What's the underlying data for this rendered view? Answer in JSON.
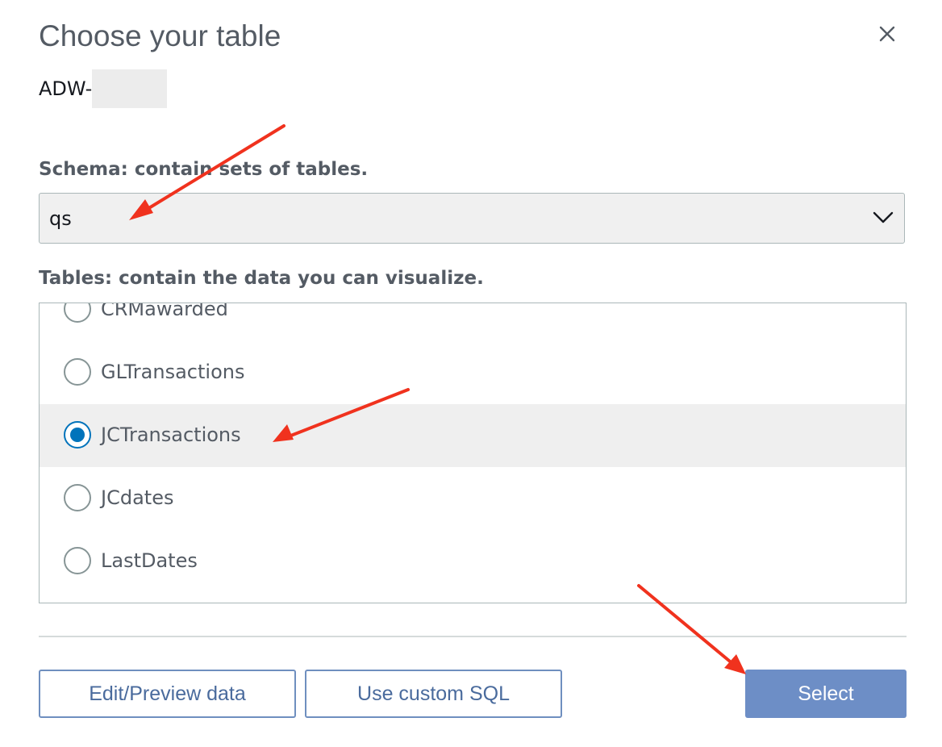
{
  "dialog": {
    "title": "Choose your table",
    "datasource_prefix": "ADW-",
    "close_icon": "close-icon"
  },
  "schema": {
    "label": "Schema: contain sets of tables.",
    "value": "qs",
    "icon": "chevron-down-icon"
  },
  "tables": {
    "label": "Tables: contain the data you can visualize.",
    "items": [
      {
        "label": "CRMawarded",
        "selected": false
      },
      {
        "label": "GLTransactions",
        "selected": false
      },
      {
        "label": "JCTransactions",
        "selected": true
      },
      {
        "label": "JCdates",
        "selected": false
      },
      {
        "label": "LastDates",
        "selected": false
      }
    ]
  },
  "buttons": {
    "edit_preview": "Edit/Preview data",
    "custom_sql": "Use custom SQL",
    "select": "Select"
  },
  "colors": {
    "accent": "#0073bb",
    "primary_button": "#6d8ec6",
    "annotation_arrow": "#f0321e"
  }
}
